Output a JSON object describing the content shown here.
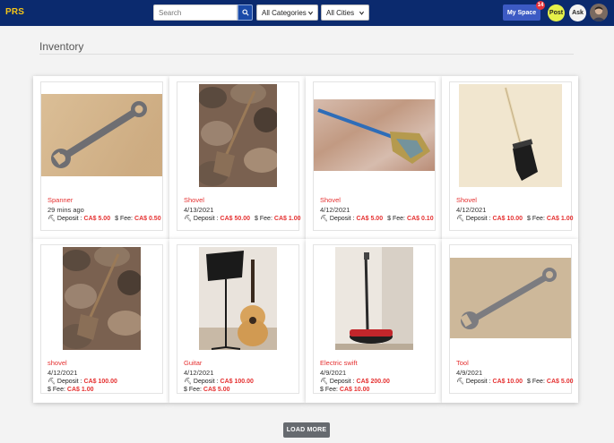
{
  "nav": {
    "brand": "PRS",
    "search_placeholder": "Search",
    "category_select": "All Categories",
    "city_select": "All Cities",
    "myspace_label": "My Space",
    "notification_count": "14",
    "post_label": "Post",
    "ask_label": "Ask"
  },
  "page": {
    "title": "Inventory",
    "load_more_label": "LOAD MORE"
  },
  "items": [
    {
      "name": "Spanner",
      "date": "29 mins ago",
      "deposit_label": "Deposit :",
      "deposit": "CA$ 5.00",
      "fee_label": "Fee:",
      "fee": "CA$ 0.50"
    },
    {
      "name": "Shovel",
      "date": "4/13/2021",
      "deposit_label": "Deposit :",
      "deposit": "CA$ 50.00",
      "fee_label": "Fee:",
      "fee": "CA$ 1.00"
    },
    {
      "name": "Shovel",
      "date": "4/12/2021",
      "deposit_label": "Deposit :",
      "deposit": "CA$ 5.00",
      "fee_label": "Fee:",
      "fee": "CA$ 0.10"
    },
    {
      "name": "Shovel",
      "date": "4/12/2021",
      "deposit_label": "Deposit :",
      "deposit": "CA$ 10.00",
      "fee_label": "Fee:",
      "fee": "CA$ 1.00"
    },
    {
      "name": "shovel",
      "date": "4/12/2021",
      "deposit_label": "Deposit :",
      "deposit": "CA$ 100.00",
      "fee_label": "Fee:",
      "fee": "CA$ 1.00"
    },
    {
      "name": "Guitar",
      "date": "4/12/2021",
      "deposit_label": "Deposit :",
      "deposit": "CA$ 100.00",
      "fee_label": "Fee:",
      "fee": "CA$ 5.00"
    },
    {
      "name": "Electric swift",
      "date": "4/9/2021",
      "deposit_label": "Deposit :",
      "deposit": "CA$ 200.00",
      "fee_label": "Fee:",
      "fee": "CA$ 10.00"
    },
    {
      "name": "Tool",
      "date": "4/9/2021",
      "deposit_label": "Deposit :",
      "deposit": "CA$ 10.00",
      "fee_label": "Fee:",
      "fee": "CA$ 5.00"
    }
  ],
  "colors": {
    "navbar": "#0b2a6e",
    "brand": "#f5c518",
    "accent_red": "#e53030",
    "myspace": "#3c5ac4"
  },
  "icons": {
    "search": "search-icon",
    "deposit": "deposit-icon",
    "fee": "dollar-icon"
  }
}
